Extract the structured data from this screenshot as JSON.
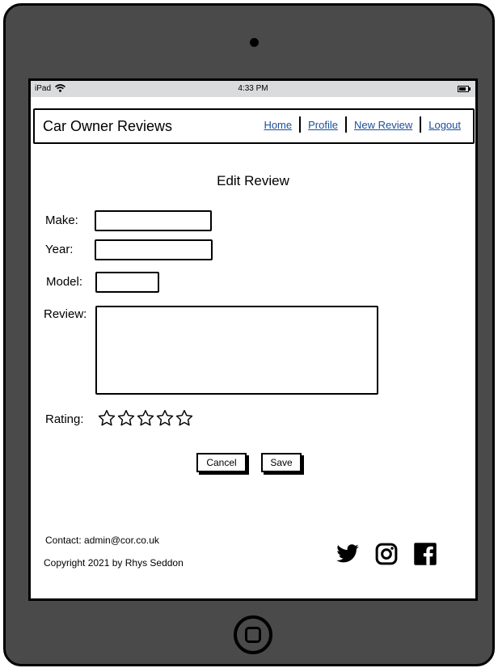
{
  "status_bar": {
    "carrier": "iPad",
    "time": "4:33 PM"
  },
  "navbar": {
    "brand": "Car Owner Reviews",
    "links": [
      "Home",
      "Profile",
      "New Review",
      "Logout"
    ],
    "link_color": "#1a4f9c"
  },
  "page": {
    "title": "Edit Review"
  },
  "form": {
    "make_label": "Make:",
    "make_value": "",
    "year_label": "Year:",
    "year_value": "",
    "model_label": "Model:",
    "model_value": "",
    "review_label": "Review:",
    "review_value": "",
    "rating_label": "Rating:",
    "rating_value": 0,
    "rating_max": 5
  },
  "buttons": {
    "cancel": "Cancel",
    "save": "Save"
  },
  "footer": {
    "contact": "Contact: admin@cor.co.uk",
    "copyright": "Copyright 2021 by Rhys Seddon",
    "social_icons": [
      "twitter-icon",
      "instagram-icon",
      "facebook-icon"
    ]
  },
  "colors": {
    "device_frame": "#4a4a4a",
    "status_bar_bg": "#d9dcdd"
  }
}
